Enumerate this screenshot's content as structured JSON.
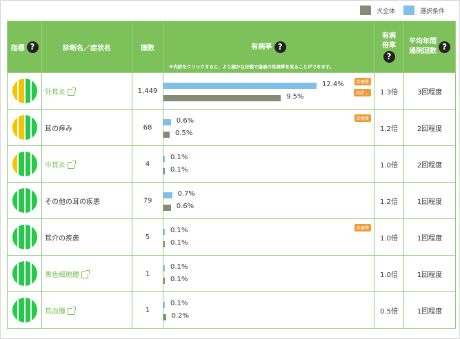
{
  "legend": {
    "all_label": "犬全体",
    "all_color": "#888a78",
    "selected_label": "選択条件",
    "selected_color": "#7fbfe8"
  },
  "header": {
    "indicator": "指標",
    "name": "診断名／症状名",
    "count": "頭数",
    "rate": "有病率",
    "rate_note": "※内訳をクリックすると、より細かな分類で傷病の有病率を見ることができます。",
    "ratio_line1": "有病",
    "ratio_line2": "倍率",
    "visits_line1": "平均年間",
    "visits_line2": "通院回数",
    "help_glyph": "?"
  },
  "rows": [
    {
      "indicator": [
        "yellow",
        "yellow",
        "green",
        "green"
      ],
      "name": "外耳炎",
      "link": true,
      "count": "1,449",
      "sel_pct": 12.4,
      "sel_label": "12.4%",
      "all_pct": 9.5,
      "all_label": "9.5%",
      "badge": "診療費",
      "badge2": "内訳 ⌄",
      "ratio": "1.3倍",
      "visits": "3回程度"
    },
    {
      "indicator": [
        "yellow",
        "yellow",
        "green",
        "green"
      ],
      "name": "耳の痒み",
      "link": false,
      "count": "68",
      "sel_pct": 0.6,
      "sel_label": "0.6%",
      "all_pct": 0.5,
      "all_label": "0.5%",
      "badge": "診療費",
      "badge2": "",
      "ratio": "1.2倍",
      "visits": "2回程度"
    },
    {
      "indicator": [
        "yellow",
        "green",
        "green",
        "green"
      ],
      "name": "中耳炎",
      "link": true,
      "count": "4",
      "sel_pct": 0.1,
      "sel_label": "0.1%",
      "all_pct": 0.1,
      "all_label": "0.1%",
      "badge": "",
      "badge2": "",
      "ratio": "1.0倍",
      "visits": "2回程度"
    },
    {
      "indicator": [
        "green",
        "green",
        "green",
        "green"
      ],
      "name": "その他の耳の疾患",
      "link": false,
      "count": "79",
      "sel_pct": 0.7,
      "sel_label": "0.7%",
      "all_pct": 0.6,
      "all_label": "0.6%",
      "badge": "",
      "badge2": "",
      "ratio": "1.2倍",
      "visits": "1回程度"
    },
    {
      "indicator": [
        "green",
        "green",
        "green",
        "green"
      ],
      "name": "耳介の疾患",
      "link": false,
      "count": "5",
      "sel_pct": 0.1,
      "sel_label": "0.1%",
      "all_pct": 0.1,
      "all_label": "0.1%",
      "badge": "診療費",
      "badge2": "",
      "ratio": "1.0倍",
      "visits": "1回程度"
    },
    {
      "indicator": [
        "green",
        "green",
        "green",
        "green"
      ],
      "name": "黒色細胞腫",
      "link": true,
      "count": "1",
      "sel_pct": 0.1,
      "sel_label": "0.1%",
      "all_pct": 0.1,
      "all_label": "0.1%",
      "badge": "",
      "badge2": "",
      "ratio": "1.0倍",
      "visits": "1回程度"
    },
    {
      "indicator": [
        "green",
        "green",
        "green",
        "green"
      ],
      "name": "耳血腫",
      "link": true,
      "count": "1",
      "sel_pct": 0.1,
      "sel_label": "0.1%",
      "all_pct": 0.2,
      "all_label": "0.2%",
      "badge": "",
      "badge2": "",
      "ratio": "0.5倍",
      "visits": "1回程度"
    }
  ],
  "indicator_colors": {
    "yellow": "#f5c400",
    "green": "#26c94a"
  },
  "bar_scale_max_pct": 12.4
}
